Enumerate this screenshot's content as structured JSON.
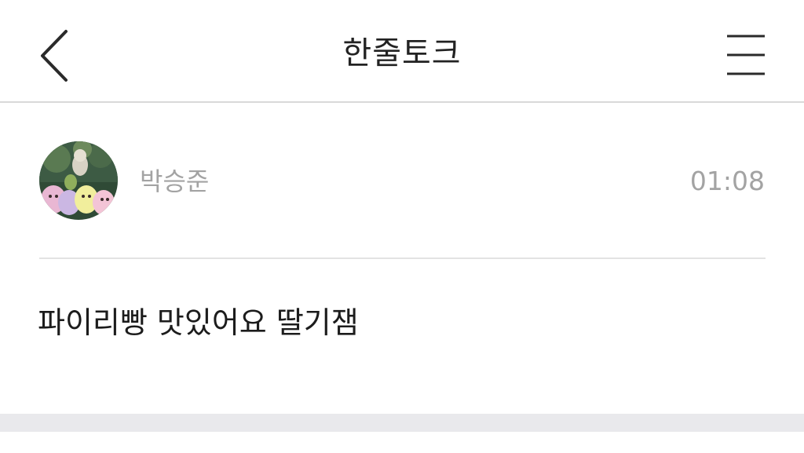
{
  "header": {
    "title": "한줄토크",
    "back_icon": "chevron-left-icon",
    "menu_icon": "hamburger-menu-icon"
  },
  "post": {
    "author": "박승준",
    "time": "01:08",
    "message": "파이리빵 맛있어요 딸기잼",
    "avatar": "avatar"
  },
  "colors": {
    "background": "#ffffff",
    "title_text": "#222222",
    "meta_text": "#a3a3a3",
    "divider": "#e3e3e3",
    "footer_band": "#e9e9ec"
  }
}
